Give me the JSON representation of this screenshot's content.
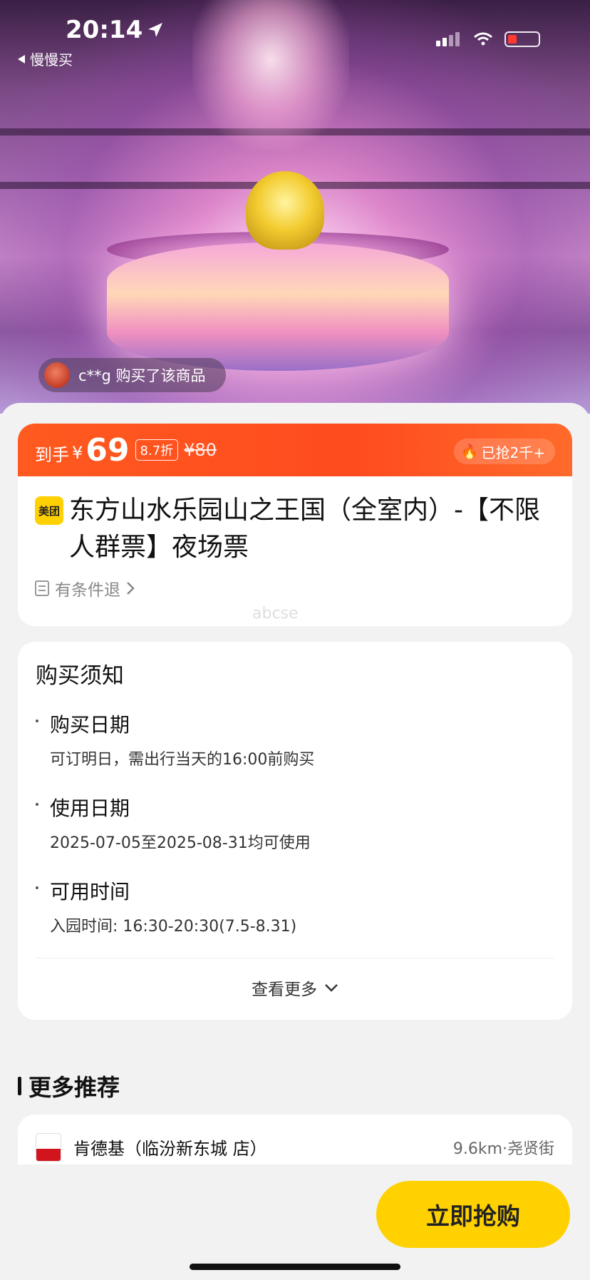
{
  "status_bar": {
    "time": "20:14",
    "back_label": "慢慢买"
  },
  "hero": {
    "toast_text": "c**g 购买了该商品"
  },
  "price": {
    "prefix": "到手",
    "currency": "¥",
    "amount": "69",
    "discount": "8.7折",
    "original": "¥80",
    "sold": "已抢2千+"
  },
  "product": {
    "brand_badge": "美团",
    "title": "东方山水乐园山之王国（全室内）-【不限人群票】夜场票",
    "refund_policy": "有条件退"
  },
  "watermark": "abcse",
  "notice": {
    "title": "购买须知",
    "items": [
      {
        "label": "购买日期",
        "value": "可订明日，需出行当天的16:00前购买"
      },
      {
        "label": "使用日期",
        "value": "2025-07-05至2025-08-31均可使用"
      },
      {
        "label": "可用时间",
        "value": "入园时间: 16:30-20:30(7.5-8.31)"
      }
    ],
    "more_label": "查看更多"
  },
  "recommend": {
    "title": "更多推荐",
    "items": [
      {
        "name": "肯德基（临汾新东城 店）",
        "distance": "9.6km·尧贤街"
      }
    ]
  },
  "buy_button": "立即抢购",
  "colors": {
    "accent_orange": "#ff4b1f",
    "accent_yellow": "#ffd100",
    "background": "#f2f2f2"
  }
}
